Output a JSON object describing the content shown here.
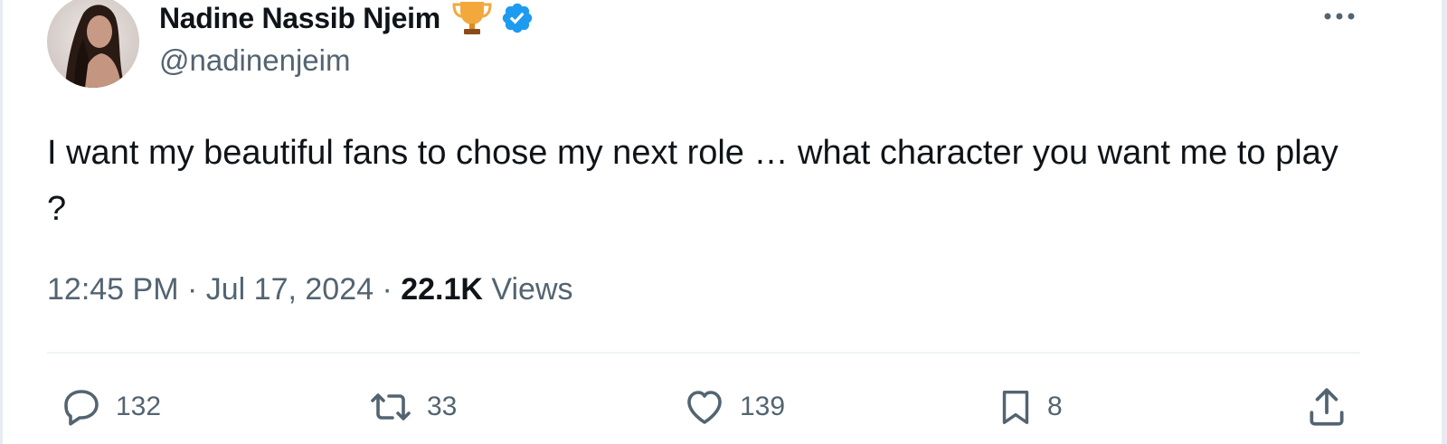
{
  "author": {
    "name": "Nadine Nassib Njeim",
    "handle": "@nadinenjeim",
    "badges": [
      "trophy-icon",
      "verified-badge-icon"
    ],
    "verified_color": "#1d9bf0"
  },
  "tweet": {
    "text": "I want my beautiful fans to chose my next role … what character you want me to play ?"
  },
  "meta": {
    "time": "12:45 PM",
    "separator": " · ",
    "date": "Jul 17, 2024",
    "views_count": "22.1K",
    "views_label": " Views"
  },
  "actions": {
    "replies": "132",
    "reposts": "33",
    "likes": "139",
    "bookmarks": "8"
  },
  "colors": {
    "text_primary": "#0f1419",
    "text_secondary": "#536471",
    "divider": "#eff3f4"
  }
}
